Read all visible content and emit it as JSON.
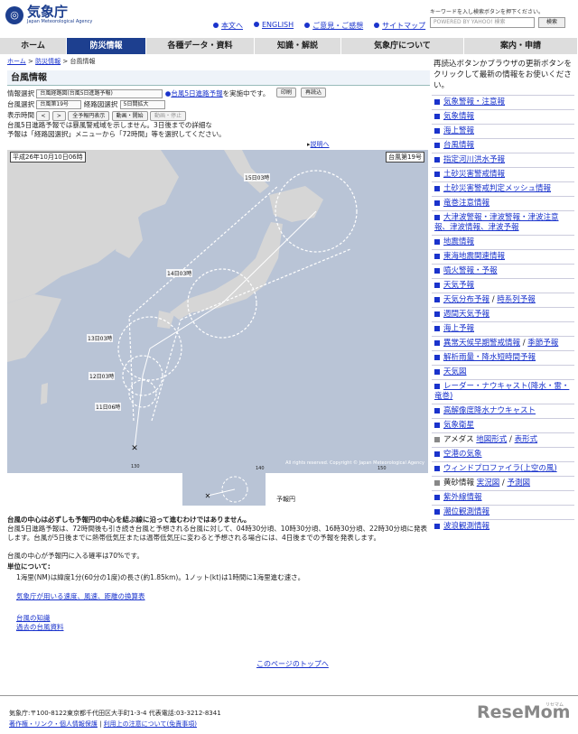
{
  "header": {
    "logo_jp": "気象庁",
    "logo_en": "Japan Meteorological Agency",
    "links": [
      "本文へ",
      "ENGLISH",
      "ご意見・ご感想",
      "サイトマップ"
    ],
    "search_hint": "キーワードを入し検索ボタンを押下ください。",
    "search_placeholder": "POWERED BY YAHOO! 検索",
    "search_button": "検索"
  },
  "nav": [
    "ホーム",
    "防災情報",
    "各種データ・資料",
    "知識・解説",
    "気象庁について",
    "案内・申請"
  ],
  "breadcrumb": {
    "home": "ホーム",
    "sec": "防災情報",
    "current": "台風情報"
  },
  "page_title": "台風情報",
  "controls": {
    "info_label": "情報選択",
    "info_value": "台風経路図(台風5日進路予報)",
    "info_note_link": "台風5日進路予報",
    "info_note_rest": "を実施中です。",
    "print": "印刷",
    "reload": "再読込",
    "typhoon_label": "台風選択",
    "typhoon_value": "台風第19号",
    "route_label": "経路図選択",
    "route_value": "5日間拡大",
    "time_label": "表示時間",
    "prev": "<",
    "next": ">",
    "all_time": "全予報円表示",
    "anim_start": "動画・開始",
    "anim_stop": "動画・停止"
  },
  "notice_line1": "台風5日進路予報では暴風警戒域を示しません。3日後までの詳細な",
  "notice_line2": "予報は「経路図選択」メニューから「72時間」等を選択してください。",
  "explain_link": "説明へ",
  "map": {
    "date": "平成26年10月10日06時",
    "name": "台風第19号",
    "labels": [
      "15日03時",
      "14日03時",
      "13日03時",
      "12日03時",
      "11日06時"
    ],
    "ticks": [
      "130",
      "140",
      "150"
    ],
    "copyright": "All rights reserved. Copyright © Japan Meteorological Agency",
    "inset_label": "予報円"
  },
  "body": {
    "bold1": "台風の中心は必ずしも予報円の中心を結ぶ線に沿って進むわけではありません。",
    "p1": "台風5日進路予報は、72時間後も引き続き台風と予想される台風に対して、04時30分頃、10時30分頃、16時30分頃、22時30分頃に発表します。台風が5日後までに熱帯低気圧または温帯低気圧に変わると予想される場合には、4日後までの予報を発表します。",
    "p2": "台風の中心が予報円に入る確率は70%です。",
    "unit_title": "単位について:",
    "unit1": "1海里(NM)は緯度1分(60分の1度)の長さ(約1.85km)。1ノット(kt)は1時間に1海里進む速さ。",
    "unit2": "気象庁が用いる速度、風速、距離の換算表",
    "link1": "台風の知識",
    "link2": "過去の台風資料",
    "top": "このページのトップへ"
  },
  "sidebar": {
    "intro": "再読込ボタンかブラウザの更新ボタンをクリックして最新の情報をお使いください。",
    "items": [
      {
        "label": "気象警報・注意報"
      },
      {
        "label": "気象情報"
      },
      {
        "label": "海上警報"
      },
      {
        "label": "台風情報"
      },
      {
        "label": "指定河川洪水予報"
      },
      {
        "label": "土砂災害警戒情報"
      },
      {
        "label": "土砂災害警戒判定メッシュ情報"
      },
      {
        "label": "竜巻注意情報"
      },
      {
        "label": "大津波警報・津波警報・津波注意報、津波情報、津波予報"
      },
      {
        "label": "地震情報"
      },
      {
        "label": "東海地震関連情報"
      },
      {
        "label": "噴火警報・予報"
      },
      {
        "label": "天気予報"
      },
      {
        "label": "天気分布予報",
        "extra": "時系列予報"
      },
      {
        "label": "週間天気予報"
      },
      {
        "label": "海上予報"
      },
      {
        "label": "異常天候早期警戒情報",
        "extra": "季節予報"
      },
      {
        "label": "解析雨量・降水短時間予報"
      },
      {
        "label": "天気図"
      },
      {
        "label": "レーダー・ナウキャスト(降水・雷・竜巻)"
      },
      {
        "label": "高解像度降水ナウキャスト"
      },
      {
        "label": "気象衛星"
      },
      {
        "label": "アメダス",
        "pre": "地図形式",
        "extra": "表形式",
        "plain": true
      },
      {
        "label": "空港の気象"
      },
      {
        "label": "ウィンドプロファイラ(上空の風)"
      },
      {
        "label": "黄砂情報",
        "pre": "実況図",
        "extra": "予測図",
        "plain": true
      },
      {
        "label": "紫外線情報"
      },
      {
        "label": "潮位観測情報"
      },
      {
        "label": "波浪観測情報"
      }
    ]
  },
  "footer": {
    "address": "気象庁:〒100-8122東京都千代田区大手町1-3-4 代表電話:03-3212-8341",
    "link_a": "著作権・リンク・個人情報保護",
    "link_b": "利用上の注意について(免責事項)",
    "brand": "ReseMom",
    "brand_sub": "リセマム"
  }
}
